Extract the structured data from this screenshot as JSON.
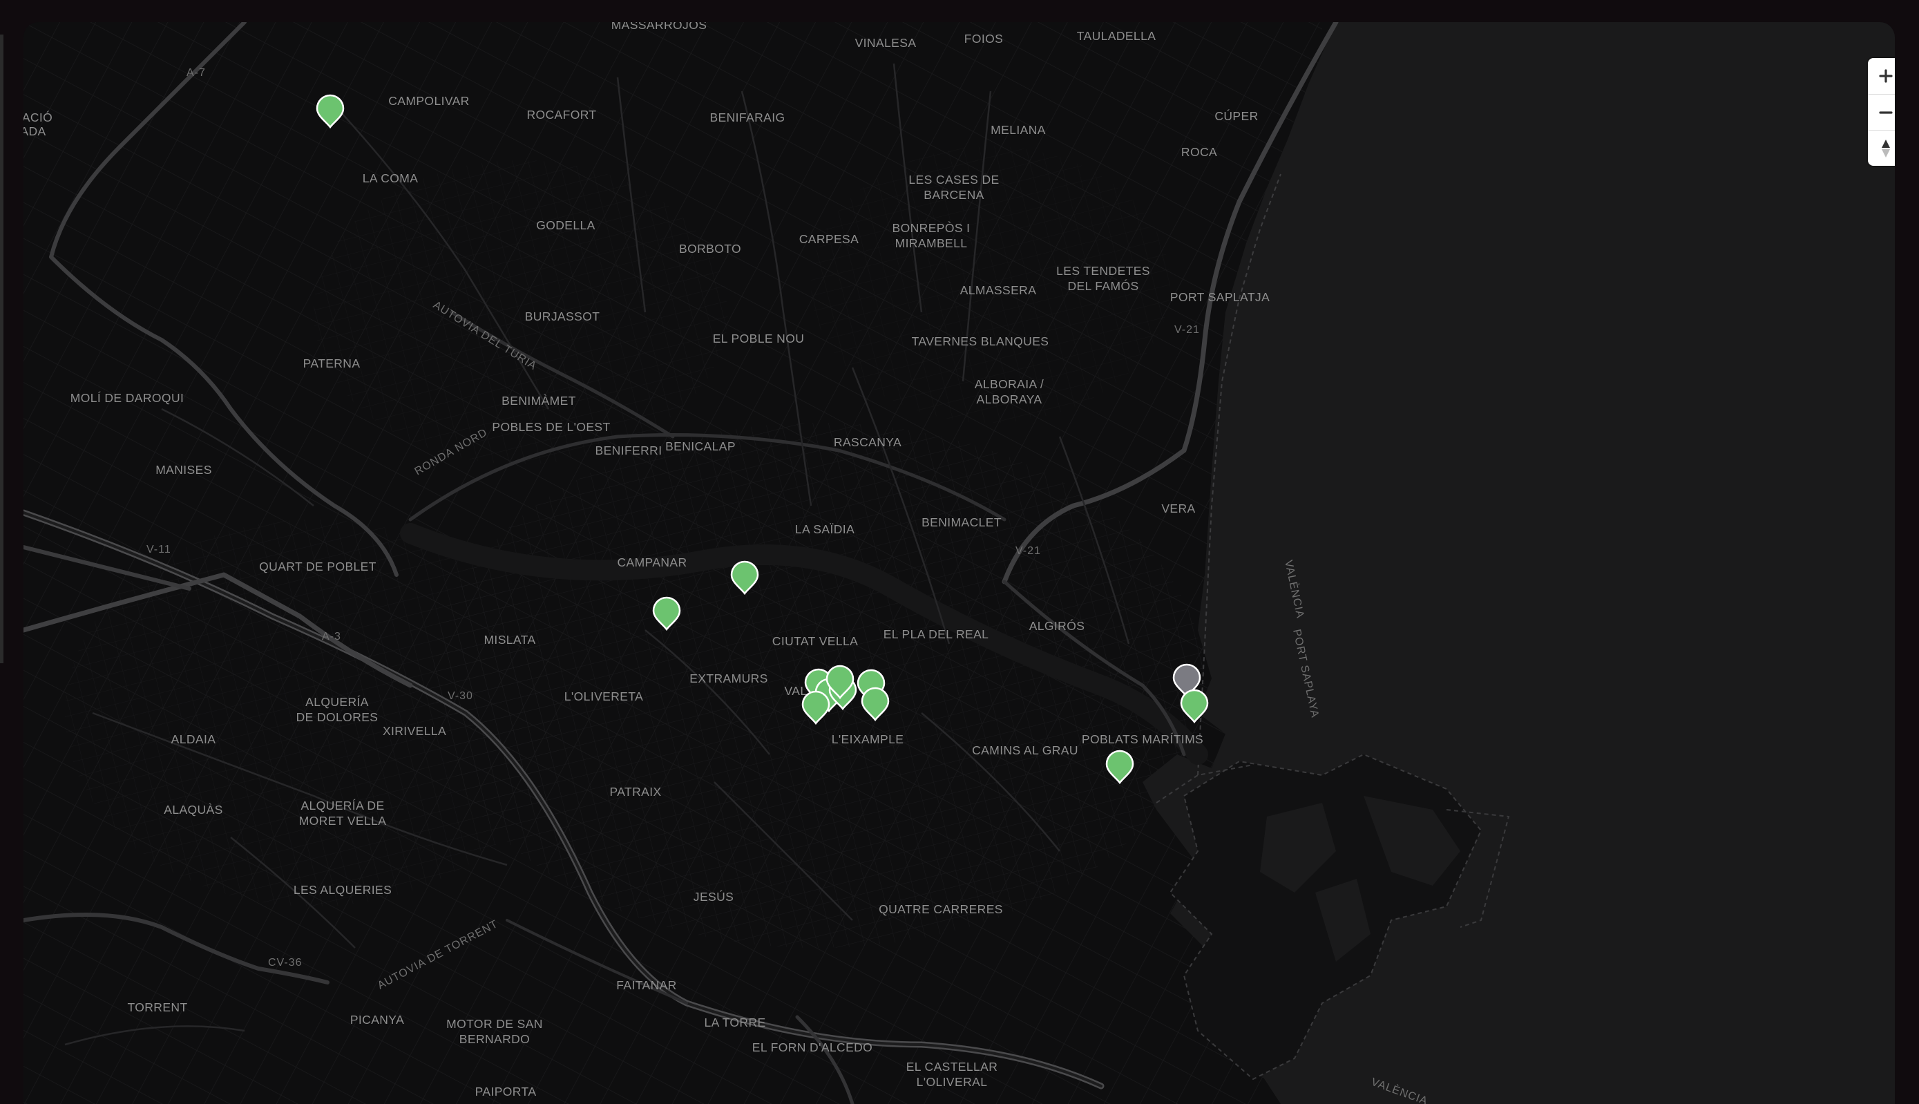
{
  "map": {
    "controls": {
      "zoom_in_icon": "plus-icon",
      "zoom_out_icon": "minus-icon",
      "reset_bearing_icon": "compass-icon"
    },
    "colors": {
      "land": "#0e0e0f",
      "sea": "#1a1a1b",
      "marker_active": "#6cc36f",
      "marker_inactive": "#7b7b82"
    },
    "place_labels": [
      "MASSARROJOS",
      "VINALESA",
      "FOIOS",
      "TAULADELLA",
      "CAMPOLIVAR",
      "ROCAFORT",
      "BENIFARAIG",
      "MELIANA",
      "CÚPER",
      "ACIÓ",
      "ADA",
      "ROCA",
      "LA COMA",
      "LES CASES DE",
      "BARCENA",
      "GODELLA",
      "BONREPÒS I",
      "MIRAMBELL",
      "CARPESA",
      "BORBOTO",
      "LES TENDETES",
      "DEL FAMÓS",
      "ALMASSERA",
      "PORT SAPLATJA",
      "BURJASSOT",
      "EL POBLE NOU",
      "TAVERNES BLANQUES",
      "PATERNA",
      "ALBORAIA /",
      "ALBORAYA",
      "MOLÍ DE DAROQUI",
      "BENIMÀMET",
      "POBLES DE L'OEST",
      "BENIFERRI",
      "BENICALAP",
      "RASCANYA",
      "MANISES",
      "VERA",
      "LA SAÏDIA",
      "BENIMACLET",
      "CAMPANAR",
      "QUART DE POBLET",
      "CIUTAT VELLA",
      "EL PLA DEL REAL",
      "ALGIRÓS",
      "MISLATA",
      "EXTRAMURS",
      "L'OLIVERETA",
      "VAL",
      "ALQUERÍA",
      "DE DOLORES",
      "XIRIVELLA",
      "ALDAIA",
      "L'EIXAMPLE",
      "POBLATS MARÍTIMS",
      "CAMINS AL GRAU",
      "PATRAIX",
      "ALAQUÀS",
      "ALQUERÍA DE",
      "MORET VELLA",
      "LES ALQUERIES",
      "JESÚS",
      "QUATRE CARRERES",
      "TORRENT",
      "FAITANAR",
      "PICANYA",
      "MOTOR DE SAN",
      "BERNARDO",
      "LA TORRE",
      "EL FORN D'ALCEDO",
      "EL CASTELLAR",
      "L'OLIVERAL",
      "PAIPORTA"
    ],
    "road_labels": [
      "A-7",
      "V-21",
      "V-21",
      "V-11",
      "A-3",
      "V-30",
      "CV-36",
      "AUTOVIA DEL TURIA",
      "RONDA NORD",
      "AUTOVIA DE TORRENT",
      "VALÈNCIA",
      "PORT SAPLAYA",
      "VALÈNCIA"
    ],
    "markers": [
      {
        "name": "marker-campolivar",
        "status": "active"
      },
      {
        "name": "marker-campanar-1",
        "status": "active"
      },
      {
        "name": "marker-campanar-2",
        "status": "active"
      },
      {
        "name": "marker-centre-1",
        "status": "active"
      },
      {
        "name": "marker-centre-2",
        "status": "active"
      },
      {
        "name": "marker-centre-3",
        "status": "active"
      },
      {
        "name": "marker-centre-4",
        "status": "active"
      },
      {
        "name": "marker-centre-5",
        "status": "active"
      },
      {
        "name": "marker-centre-6",
        "status": "active"
      },
      {
        "name": "marker-centre-7",
        "status": "active"
      },
      {
        "name": "marker-malvarrosa-grey",
        "status": "inactive"
      },
      {
        "name": "marker-malvarrosa",
        "status": "active"
      },
      {
        "name": "marker-poblats-maritims",
        "status": "active"
      }
    ]
  }
}
